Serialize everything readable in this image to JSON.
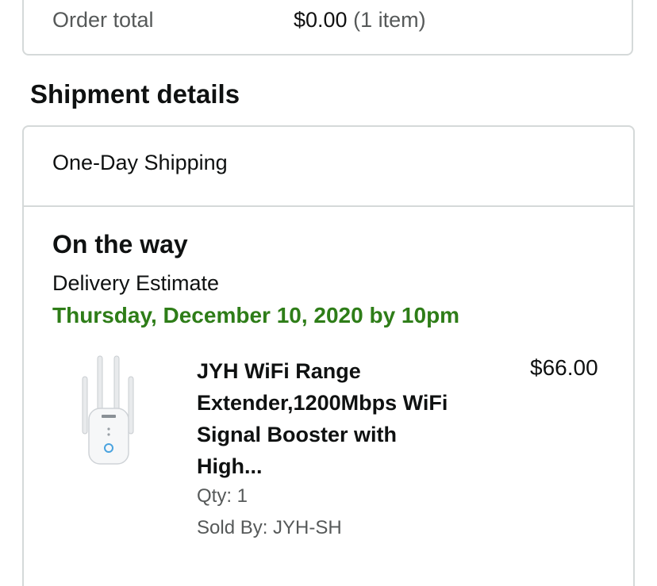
{
  "order_summary": {
    "total_label": "Order total",
    "total_value": "$0.00",
    "item_count": "(1 item)"
  },
  "shipment": {
    "section_title": "Shipment details",
    "method": "One-Day Shipping",
    "status": "On the way",
    "estimate_label": "Delivery Estimate",
    "estimate_date": "Thursday, December 10, 2020 by 10pm",
    "items": [
      {
        "title": "JYH WiFi Range Extender,1200Mbps WiFi Signal Booster with High...",
        "price": "$66.00",
        "quantity": "Qty: 1",
        "seller": "Sold By: JYH-SH",
        "image_icon": "wifi-extender-product-image"
      }
    ]
  },
  "colors": {
    "delivery_green": "#2e7d18",
    "muted_text": "#565959",
    "border": "#d5d9d9"
  }
}
